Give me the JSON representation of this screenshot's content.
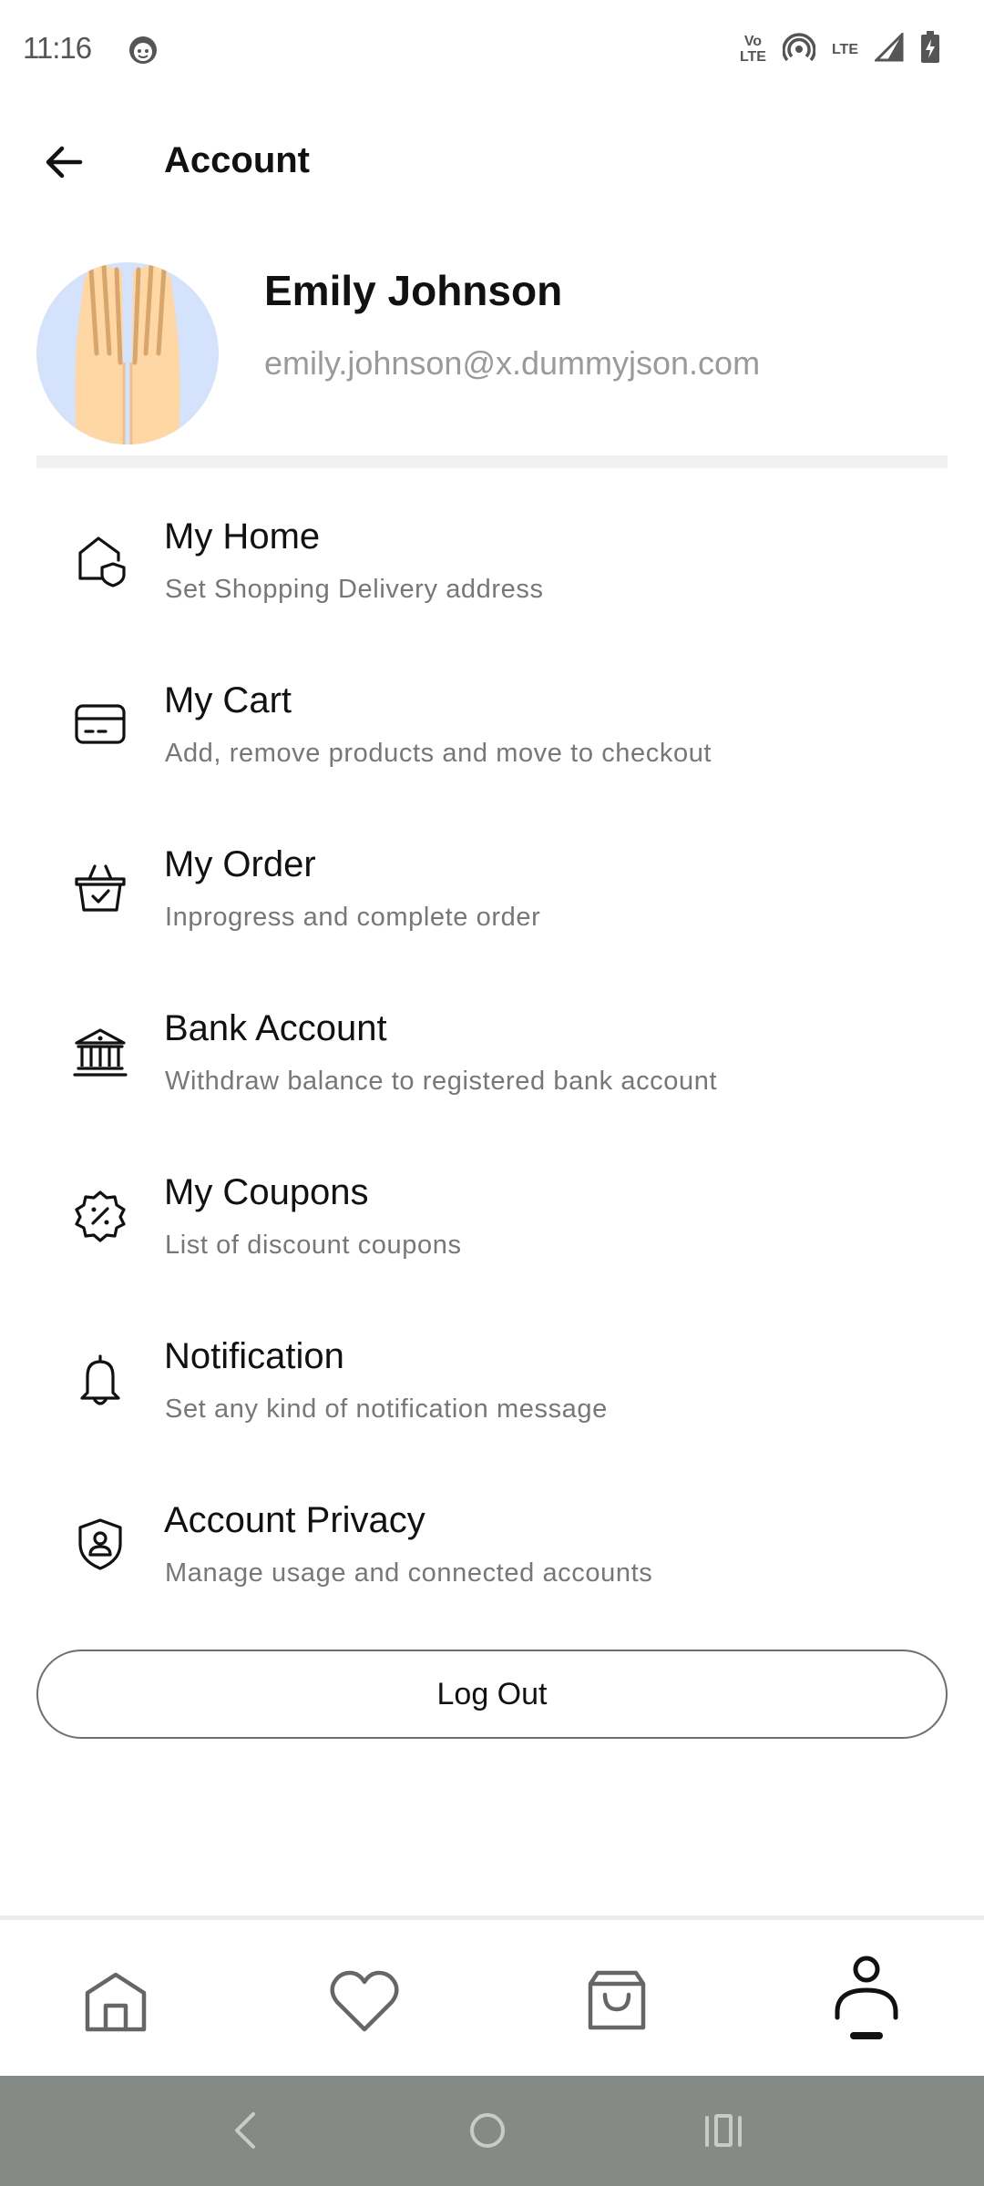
{
  "status_bar": {
    "time": "11:16",
    "volte_top": "Vo",
    "volte_bottom": "LTE",
    "lte_label": "LTE"
  },
  "app_bar": {
    "title": "Account"
  },
  "profile": {
    "name": "Emily Johnson",
    "email": "emily.johnson@x.dummyjson.com"
  },
  "menu": {
    "items": [
      {
        "icon": "home-shield-icon",
        "title": "My Home",
        "subtitle": "Set Shopping Delivery address"
      },
      {
        "icon": "card-icon",
        "title": "My Cart",
        "subtitle": "Add, remove products and move to checkout"
      },
      {
        "icon": "basket-check-icon",
        "title": "My Order",
        "subtitle": "Inprogress and complete order"
      },
      {
        "icon": "bank-icon",
        "title": "Bank Account",
        "subtitle": "Withdraw balance to registered bank account"
      },
      {
        "icon": "discount-badge-icon",
        "title": "My Coupons",
        "subtitle": "List of discount coupons"
      },
      {
        "icon": "bell-icon",
        "title": "Notification",
        "subtitle": "Set any kind of notification message"
      },
      {
        "icon": "shield-user-icon",
        "title": "Account Privacy",
        "subtitle": "Manage usage and connected accounts"
      }
    ]
  },
  "logout": {
    "label": "Log Out"
  },
  "bottom_nav": {
    "items": [
      "home-icon",
      "heart-icon",
      "shopping-bag-icon",
      "user-icon"
    ],
    "active": "user-icon"
  },
  "colors": {
    "text": "#111111",
    "subtitle": "#777777",
    "email": "#9a9a9a",
    "avatar_bg": "#d5e2fb",
    "system_nav_bg": "#868a87"
  }
}
